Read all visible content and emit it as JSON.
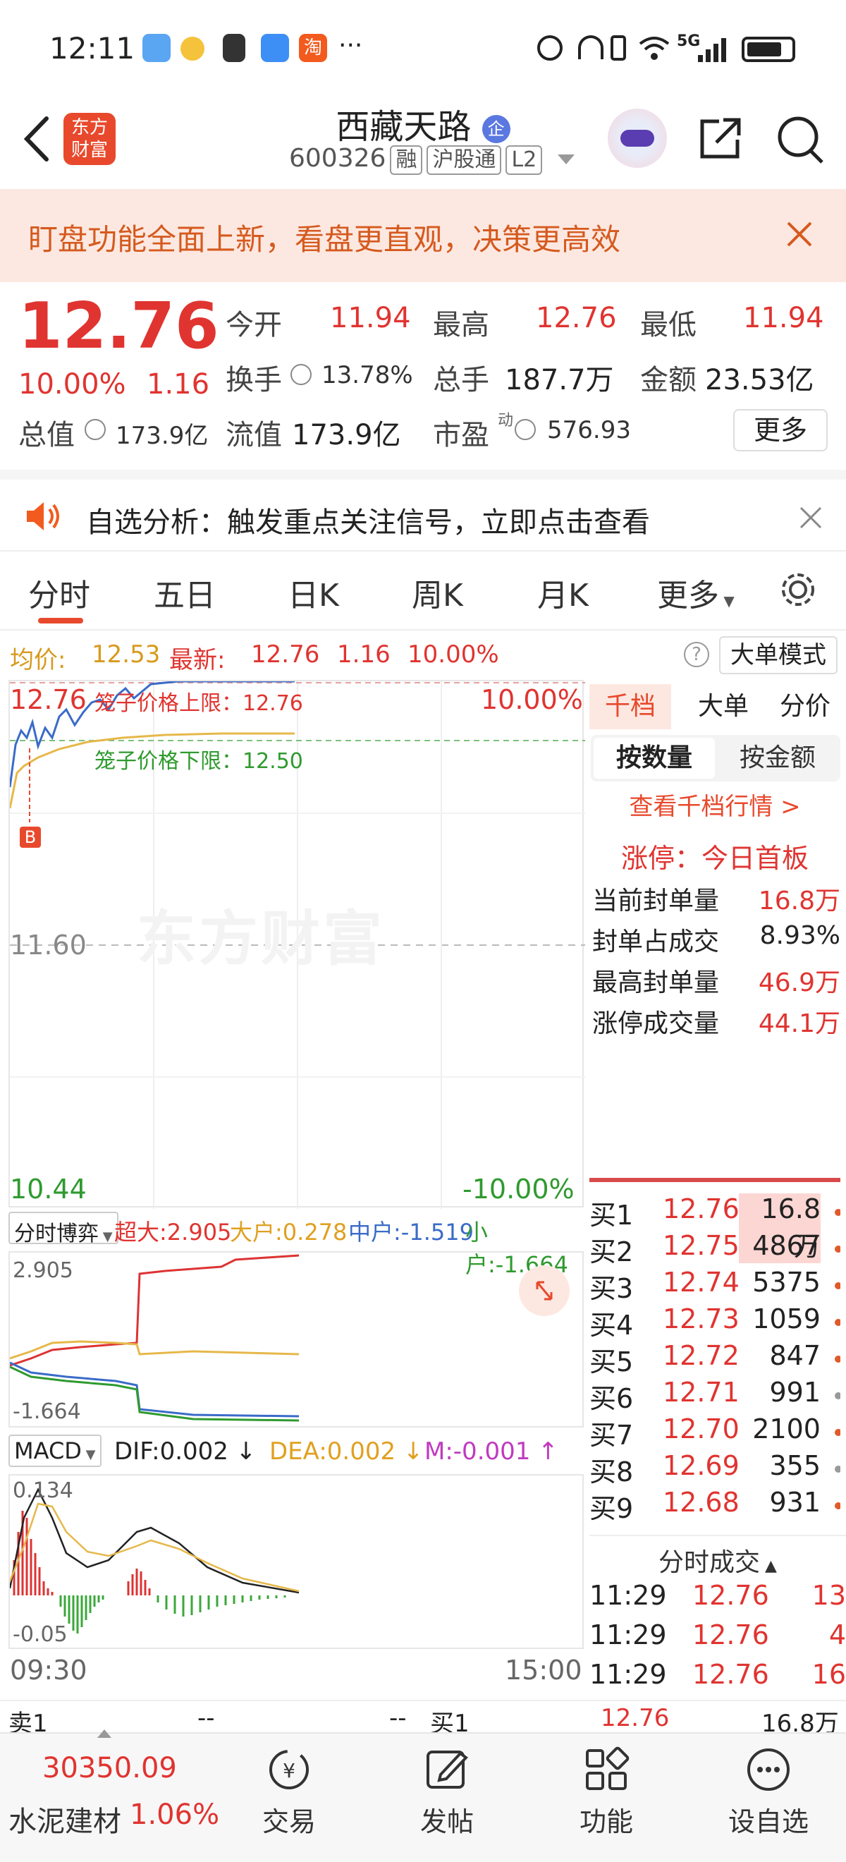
{
  "status_bar": {
    "time": "12:11",
    "network": "5G"
  },
  "header": {
    "title": "西藏天路",
    "badge": "企",
    "code": "600326",
    "tags": [
      "融",
      "沪股通",
      "L2"
    ]
  },
  "banner": {
    "text": "盯盘功能全面上新，看盘更直观，决策更高效"
  },
  "quote": {
    "price": "12.76",
    "change_pct": "10.00%",
    "change": "1.16",
    "open_label": "今开",
    "open": "11.94",
    "high_label": "最高",
    "high": "12.76",
    "low_label": "最低",
    "low": "11.94",
    "turnover_label": "换手",
    "turnover": "13.78%",
    "volume_label": "总手",
    "volume": "187.7万",
    "amount_label": "金额",
    "amount": "23.53亿",
    "mktcap_label": "总值",
    "mktcap": "173.9亿",
    "float_label": "流值",
    "float": "173.9亿",
    "pe_label": "市盈",
    "pe_sup": "动",
    "pe": "576.93",
    "more_label": "更多"
  },
  "notice": {
    "text": "自选分析：触发重点关注信号，立即点击查看"
  },
  "tabs": [
    "分时",
    "五日",
    "日K",
    "周K",
    "月K",
    "更多"
  ],
  "chart_info": {
    "avg_label": "均价:",
    "avg": "12.53",
    "latest_label": "最新:",
    "latest": "12.76",
    "chg": "1.16",
    "pct": "10.00%",
    "mode_label": "大单模式"
  },
  "chart_data": {
    "type": "line",
    "title": "",
    "x": [
      "09:30",
      "15:00"
    ],
    "ylim": [
      10.44,
      12.76
    ],
    "y_top_label": "12.76",
    "y_mid_label": "11.60",
    "y_bottom_label": "10.44",
    "pct_top_label": "10.00%",
    "pct_bottom_label": "-10.00%",
    "upper_limit_label": "笼子价格上限：12.76",
    "lower_limit_label": "笼子价格下限：12.50",
    "buy_marker": "B",
    "watermark": "东方财富",
    "series": []
  },
  "fund_flow": {
    "selector": "分时博弈",
    "super_label": "超大:",
    "super": "2.905",
    "large_label": "大户:",
    "large": "0.278",
    "mid_label": "中户:",
    "mid": "-1.519",
    "small_label": "小户:",
    "small": "-1.664",
    "ymax": "2.905",
    "ymin": "-1.664"
  },
  "macd": {
    "selector": "MACD",
    "dif": "DIF:0.002",
    "dea": "DEA:0.002",
    "m": "M:-0.001",
    "ymax": "0.134",
    "ymin": "-0.05",
    "time_start": "09:30",
    "time_end": "15:00"
  },
  "side": {
    "tabs": [
      "千档",
      "大单",
      "分价"
    ],
    "subtabs": [
      "按数量",
      "按金额"
    ],
    "link": "查看千档行情 >",
    "limit_title": "涨停：今日首板",
    "stats": [
      {
        "label": "当前封单量",
        "value": "16.8万"
      },
      {
        "label": "封单占成交",
        "value": "8.93%"
      },
      {
        "label": "最高封单量",
        "value": "46.9万"
      },
      {
        "label": "涨停成交量",
        "value": "44.1万"
      }
    ],
    "bids": [
      {
        "label": "买1",
        "price": "12.76",
        "vol": "16.8万",
        "dot": "#e05a2a"
      },
      {
        "label": "买2",
        "price": "12.75",
        "vol": "4867",
        "dot": "#e05a2a"
      },
      {
        "label": "买3",
        "price": "12.74",
        "vol": "5375",
        "dot": "#e05a2a"
      },
      {
        "label": "买4",
        "price": "12.73",
        "vol": "1059",
        "dot": "#e05a2a"
      },
      {
        "label": "买5",
        "price": "12.72",
        "vol": "847",
        "dot": "#e05a2a"
      },
      {
        "label": "买6",
        "price": "12.71",
        "vol": "991",
        "dot": "#999999"
      },
      {
        "label": "买7",
        "price": "12.70",
        "vol": "2100",
        "dot": "#e05a2a"
      },
      {
        "label": "买8",
        "price": "12.69",
        "vol": "355",
        "dot": "#999999"
      },
      {
        "label": "买9",
        "price": "12.68",
        "vol": "931",
        "dot": "#e05a2a"
      }
    ],
    "trades_title": "分时成交",
    "trades": [
      {
        "time": "11:29",
        "price": "12.76",
        "vol": "13"
      },
      {
        "time": "11:29",
        "price": "12.76",
        "vol": "4"
      },
      {
        "time": "11:29",
        "price": "12.76",
        "vol": "16"
      }
    ]
  },
  "bottom_strip": {
    "sell1_label": "卖1",
    "sell1_price": "--",
    "sell1_vol": "--",
    "buy1_label": "买1",
    "buy1_price": "12.76",
    "buy1_vol": "16.8万"
  },
  "bottom_nav": {
    "index_value": "30350.09",
    "index_name": "水泥建材",
    "index_pct": "1.06%",
    "items": [
      "交易",
      "发帖",
      "功能",
      "设自选"
    ]
  }
}
